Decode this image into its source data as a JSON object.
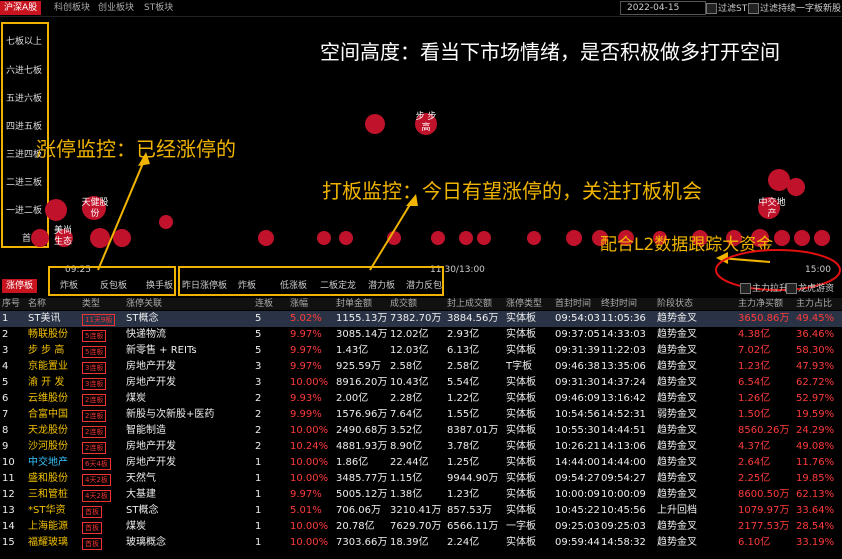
{
  "top_tabs": [
    "沪深A股",
    "科创板块",
    "创业板块",
    "ST板块"
  ],
  "date_value": "2022-04-15",
  "filters": [
    "过滤ST",
    "过滤持续一字板新股"
  ],
  "levels": [
    "七板以上",
    "六进七板",
    "五进六板",
    "四进五板",
    "三进四板",
    "二进三板",
    "一进二板",
    "首板"
  ],
  "annotations": {
    "space": "空间高度：看当下市场情绪，是否积极做多打开空间",
    "limit_up": "涨停监控：已经涨停的",
    "board_watch": "打板监控：今日有望涨停的，关注打板机会",
    "l2": "配合L2数据跟踪大资金"
  },
  "bubble_labels": [
    "步 步\n高",
    "天健股\n份",
    "中交地\n产",
    "美尚\n生态"
  ],
  "time_ticks": {
    "start": "09:25",
    "mid": "11:30/13:00",
    "end": "15:00"
  },
  "legend": [
    "主力拉升",
    "龙虎游资"
  ],
  "sub_tabs": [
    "涨停板",
    "炸板",
    "反包板",
    "换手板",
    "昨日涨停板",
    "炸板",
    "低涨板",
    "二板定龙",
    "潜力板",
    "潜力反包"
  ],
  "columns": [
    "序号",
    "名称",
    "类型",
    "涨停关联",
    "连板",
    "涨幅",
    "封单金额",
    "成交额",
    "封上成交额",
    "涨停类型",
    "首封时间",
    "终封时间",
    "阶段状态",
    "主力净买额",
    "主力占比"
  ],
  "rows": [
    {
      "n": "1",
      "name": "ST美讯",
      "tag": "11天9板",
      "rel": "ST概念",
      "lb": "5",
      "pct": "5.02%",
      "fd": "1155.13万",
      "cje": "7382.70万",
      "fs": "3884.56万",
      "type": "实体板",
      "t1": "09:54:03",
      "t2": "11:05:36",
      "stage": "趋势金叉",
      "net": "3650.86万",
      "ratio": "49.45%"
    },
    {
      "n": "2",
      "name": "畅联股份",
      "tag": "5连板",
      "rel": "快递物流",
      "lb": "5",
      "pct": "9.97%",
      "fd": "3085.14万",
      "cje": "12.02亿",
      "fs": "2.93亿",
      "type": "实体板",
      "t1": "09:37:05",
      "t2": "14:33:03",
      "stage": "趋势金叉",
      "net": "4.38亿",
      "ratio": "36.46%"
    },
    {
      "n": "3",
      "name": "步 步 高",
      "tag": "5连板",
      "rel": "新零售 + REITs",
      "lb": "5",
      "pct": "9.97%",
      "fd": "1.43亿",
      "cje": "12.03亿",
      "fs": "6.13亿",
      "type": "实体板",
      "t1": "09:31:39",
      "t2": "11:22:03",
      "stage": "趋势金叉",
      "net": "7.02亿",
      "ratio": "58.30%"
    },
    {
      "n": "4",
      "name": "京能置业",
      "tag": "3连板",
      "rel": "房地产开发",
      "lb": "3",
      "pct": "9.97%",
      "fd": "925.59万",
      "cje": "2.58亿",
      "fs": "2.58亿",
      "type": "T字板",
      "t1": "09:46:38",
      "t2": "13:35:06",
      "stage": "趋势金叉",
      "net": "1.23亿",
      "ratio": "47.93%"
    },
    {
      "n": "5",
      "name": "渝 开 发",
      "tag": "3连板",
      "rel": "房地产开发",
      "lb": "3",
      "pct": "10.00%",
      "fd": "8916.20万",
      "cje": "10.43亿",
      "fs": "5.54亿",
      "type": "实体板",
      "t1": "09:31:30",
      "t2": "14:37:24",
      "stage": "趋势金叉",
      "net": "6.54亿",
      "ratio": "62.72%"
    },
    {
      "n": "6",
      "name": "云维股份",
      "tag": "2连板",
      "rel": "煤炭",
      "lb": "2",
      "pct": "9.93%",
      "fd": "2.00亿",
      "cje": "2.28亿",
      "fs": "1.22亿",
      "type": "实体板",
      "t1": "09:46:09",
      "t2": "13:16:42",
      "stage": "趋势金叉",
      "net": "1.26亿",
      "ratio": "52.97%"
    },
    {
      "n": "7",
      "name": "合富中国",
      "tag": "2连板",
      "rel": "新股与次新股+医药",
      "lb": "2",
      "pct": "9.99%",
      "fd": "1576.96万",
      "cje": "7.64亿",
      "fs": "1.55亿",
      "type": "实体板",
      "t1": "10:54:56",
      "t2": "14:52:31",
      "stage": "弱势金叉",
      "net": "1.50亿",
      "ratio": "19.59%"
    },
    {
      "n": "8",
      "name": "天龙股份",
      "tag": "2连板",
      "rel": "智能制造",
      "lb": "2",
      "pct": "10.00%",
      "fd": "2490.68万",
      "cje": "3.52亿",
      "fs": "8387.01万",
      "type": "实体板",
      "t1": "10:55:30",
      "t2": "14:44:51",
      "stage": "趋势金叉",
      "net": "8560.26万",
      "ratio": "24.29%"
    },
    {
      "n": "9",
      "name": "沙河股份",
      "tag": "2连板",
      "rel": "房地产开发",
      "lb": "2",
      "pct": "10.24%",
      "fd": "4881.93万",
      "cje": "8.90亿",
      "fs": "3.78亿",
      "type": "实体板",
      "t1": "10:26:21",
      "t2": "14:13:06",
      "stage": "趋势金叉",
      "net": "4.37亿",
      "ratio": "49.08%"
    },
    {
      "n": "10",
      "name": "中交地产",
      "tag": "6天4板",
      "rel": "房地产开发",
      "lb": "1",
      "pct": "10.00%",
      "fd": "1.86亿",
      "cje": "22.44亿",
      "fs": "1.25亿",
      "type": "实体板",
      "t1": "14:44:00",
      "t2": "14:44:00",
      "stage": "趋势金叉",
      "net": "2.64亿",
      "ratio": "11.76%"
    },
    {
      "n": "11",
      "name": "盛和股份",
      "tag": "4天2板",
      "rel": "天然气",
      "lb": "1",
      "pct": "10.00%",
      "fd": "3485.77万",
      "cje": "1.15亿",
      "fs": "9944.90万",
      "type": "实体板",
      "t1": "09:54:27",
      "t2": "09:54:27",
      "stage": "趋势金叉",
      "net": "2.25亿",
      "ratio": "19.85%"
    },
    {
      "n": "12",
      "name": "三和管桩",
      "tag": "4天2板",
      "rel": "大基建",
      "lb": "1",
      "pct": "9.97%",
      "fd": "5005.12万",
      "cje": "1.38亿",
      "fs": "1.23亿",
      "type": "实体板",
      "t1": "10:00:09",
      "t2": "10:00:09",
      "stage": "趋势金叉",
      "net": "8600.50万",
      "ratio": "62.13%"
    },
    {
      "n": "13",
      "name": "*ST华资",
      "tag": "首板",
      "rel": "ST概念",
      "lb": "1",
      "pct": "5.01%",
      "fd": "706.06万",
      "cje": "3210.41万",
      "fs": "857.53万",
      "type": "实体板",
      "t1": "10:45:22",
      "t2": "10:45:56",
      "stage": "上升回档",
      "net": "1079.97万",
      "ratio": "33.64%"
    },
    {
      "n": "14",
      "name": "上海能源",
      "tag": "首板",
      "rel": "煤炭",
      "lb": "1",
      "pct": "10.00%",
      "fd": "20.78亿",
      "cje": "7629.70万",
      "fs": "6566.11万",
      "type": "一字板",
      "t1": "09:25:03",
      "t2": "09:25:03",
      "stage": "趋势金叉",
      "net": "2177.53万",
      "ratio": "28.54%"
    },
    {
      "n": "15",
      "name": "福耀玻璃",
      "tag": "首板",
      "rel": "玻璃概念",
      "lb": "1",
      "pct": "10.00%",
      "fd": "7303.66万",
      "cje": "18.39亿",
      "fs": "2.24亿",
      "type": "实体板",
      "t1": "09:59:44",
      "t2": "14:58:32",
      "stage": "趋势金叉",
      "net": "6.10亿",
      "ratio": "33.19%"
    }
  ],
  "colors": {
    "accent": "#c8141e",
    "annotation": "#f0b400",
    "bubble": "#c0132b"
  }
}
